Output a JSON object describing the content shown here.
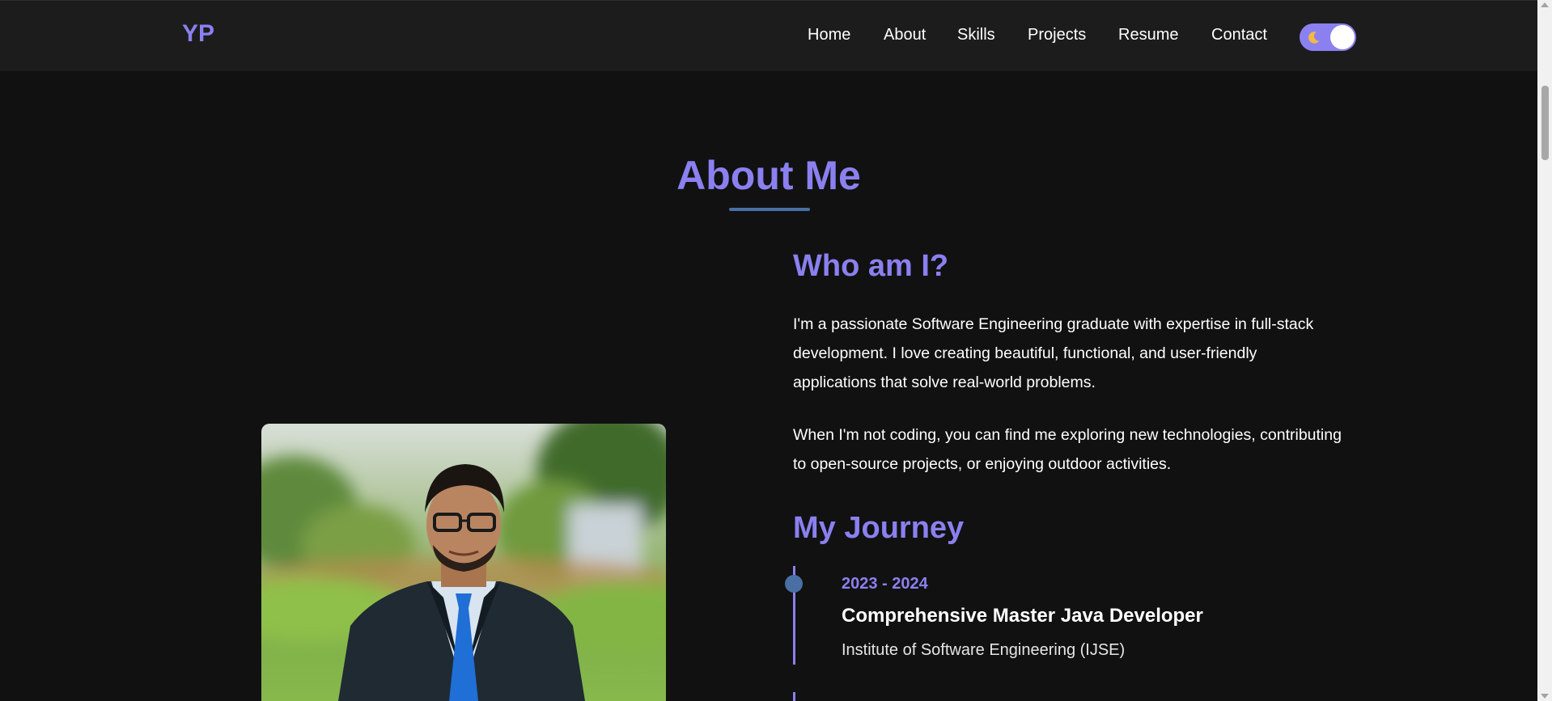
{
  "navbar": {
    "logo": "YP",
    "links": [
      "Home",
      "About",
      "Skills",
      "Projects",
      "Resume",
      "Contact"
    ],
    "theme_toggle": {
      "icon": "moon-icon",
      "state": "dark"
    }
  },
  "about": {
    "title": "About Me",
    "who_heading": "Who am I?",
    "paragraphs": [
      "I'm a passionate Software Engineering graduate with expertise in full-stack development. I love creating beautiful, functional, and user-friendly applications that solve real-world problems.",
      "When I'm not coding, you can find me exploring new technologies, contributing to open-source projects, or enjoying outdoor activities."
    ],
    "journey_heading": "My Journey",
    "timeline": [
      {
        "date": "2023 - 2024",
        "title": "Comprehensive Master Java Developer",
        "org": "Institute of Software Engineering (IJSE)"
      }
    ]
  },
  "colors": {
    "accent": "#8b80f0",
    "secondary": "#4a6fa5",
    "background": "#111111",
    "navbar": "#1c1c1c"
  }
}
